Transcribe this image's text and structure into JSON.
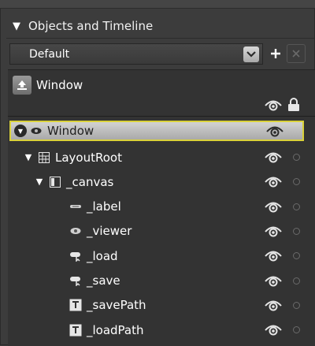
{
  "panel": {
    "title": "Objects and Timeline"
  },
  "storyboard": {
    "selected": "Default"
  },
  "scope": {
    "label": "Window"
  },
  "tree": {
    "root": {
      "label": "Window"
    },
    "items": [
      {
        "label": "LayoutRoot",
        "icon": "grid-icon",
        "level": 1,
        "expander": "▼"
      },
      {
        "label": "_canvas",
        "icon": "canvas-icon",
        "level": 2,
        "expander": "▼"
      },
      {
        "label": "_label",
        "icon": "label-icon",
        "level": 3,
        "expander": ""
      },
      {
        "label": "_viewer",
        "icon": "viewer-icon",
        "level": 3,
        "expander": ""
      },
      {
        "label": "_load",
        "icon": "button-icon",
        "level": 3,
        "expander": ""
      },
      {
        "label": "_save",
        "icon": "button-icon",
        "level": 3,
        "expander": ""
      },
      {
        "label": "_savePath",
        "icon": "textbox-icon",
        "level": 3,
        "expander": ""
      },
      {
        "label": "_loadPath",
        "icon": "textbox-icon",
        "level": 3,
        "expander": ""
      }
    ]
  },
  "colors": {
    "selection_border": "#d9d13a",
    "panel_bg": "#3c3c3c"
  }
}
